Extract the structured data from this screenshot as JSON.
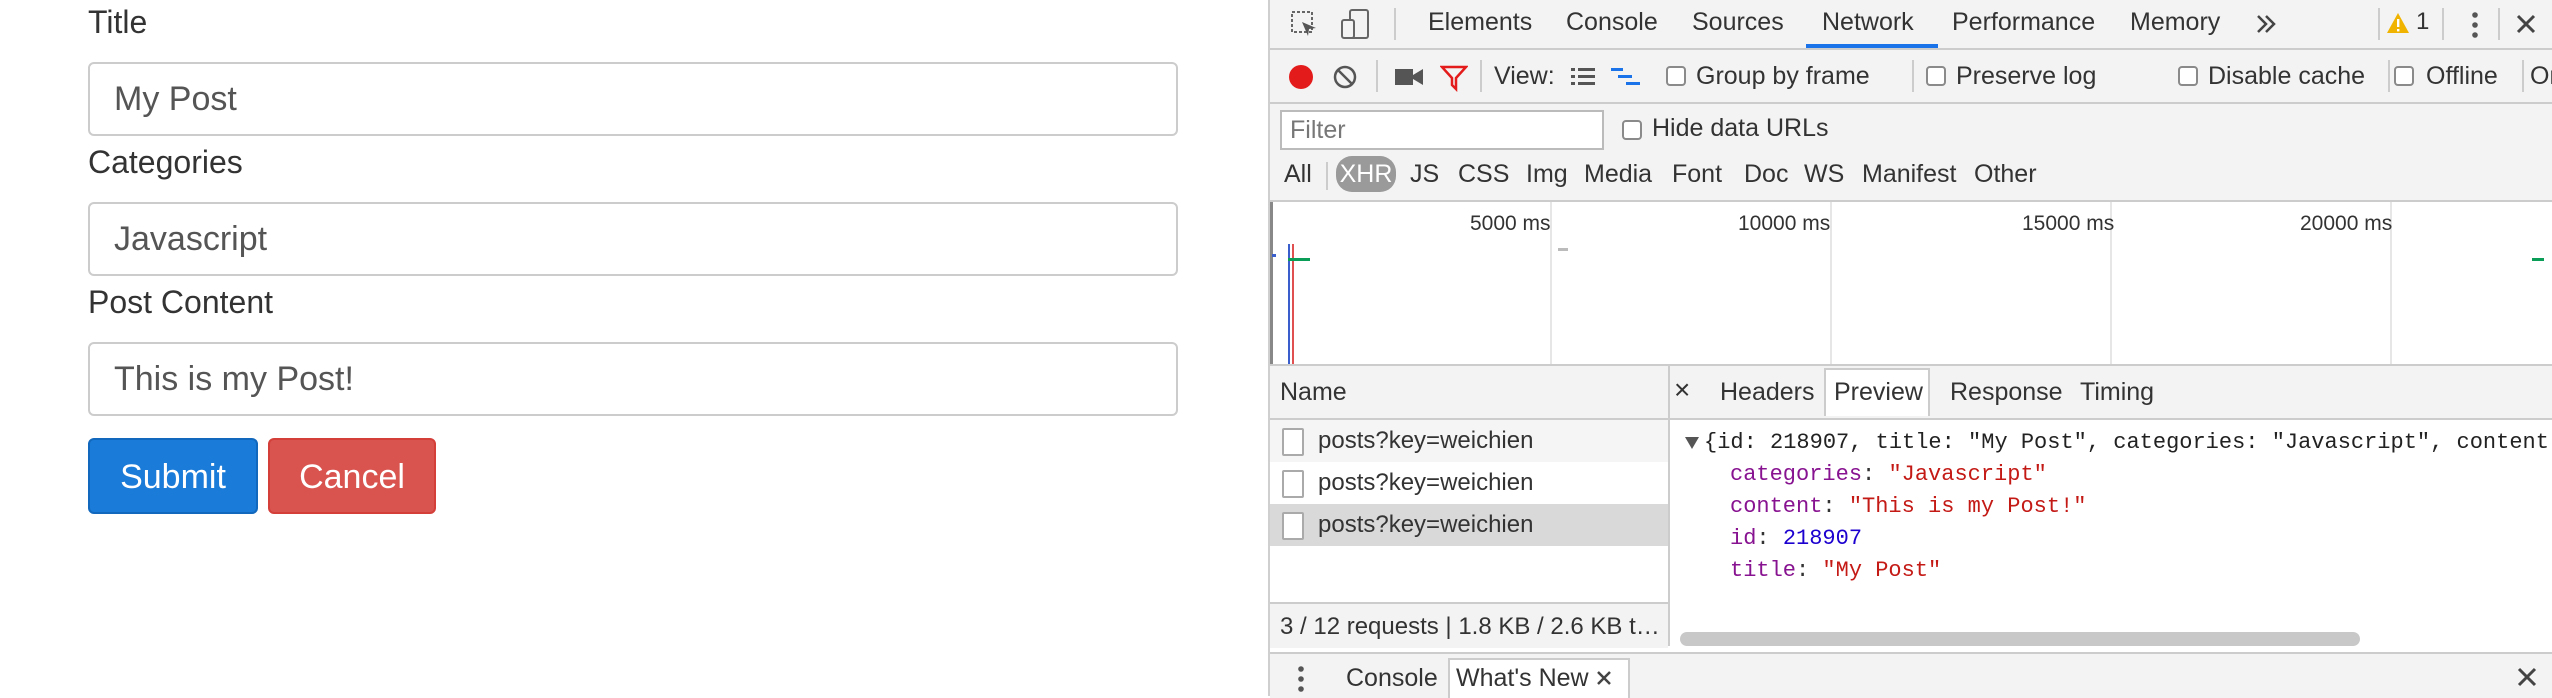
{
  "form": {
    "title_label": "Title",
    "title_value": "My Post",
    "categories_label": "Categories",
    "categories_value": "Javascript",
    "content_label": "Post Content",
    "content_value": "This is my Post!",
    "submit_label": "Submit",
    "cancel_label": "Cancel",
    "colors": {
      "submit": "#1a7bd8",
      "cancel": "#d9534f"
    }
  },
  "devtools": {
    "tabs": [
      "Elements",
      "Console",
      "Sources",
      "Network",
      "Performance",
      "Memory"
    ],
    "active_tab": "Network",
    "more_tabs_icon": "double-chevron-right-icon",
    "warning_count": "1",
    "toolbar": {
      "view_label": "View:",
      "group_by_frame": "Group by frame",
      "preserve_log": "Preserve log",
      "disable_cache": "Disable cache",
      "offline": "Offline",
      "online_truncated": "Onl"
    },
    "filter": {
      "placeholder": "Filter",
      "hide_data_urls": "Hide data URLs",
      "types": [
        "All",
        "XHR",
        "JS",
        "CSS",
        "Img",
        "Media",
        "Font",
        "Doc",
        "WS",
        "Manifest",
        "Other"
      ],
      "active_type": "XHR"
    },
    "timeline": {
      "ticks": [
        "5000 ms",
        "10000 ms",
        "15000 ms",
        "20000 ms"
      ]
    },
    "requests": {
      "header": "Name",
      "rows": [
        "posts?key=weichien",
        "posts?key=weichien",
        "posts?key=weichien"
      ],
      "status": "3 / 12 requests | 1.8 KB / 2.6 KB t…"
    },
    "detail": {
      "close": "×",
      "tabs": [
        "Headers",
        "Preview",
        "Response",
        "Timing"
      ],
      "active_tab": "Preview",
      "summary": "{id: 218907, title: \"My Post\", categories: \"Javascript\", content",
      "props": [
        {
          "key": "categories",
          "value": "\"Javascript\"",
          "kind": "string"
        },
        {
          "key": "content",
          "value": "\"This is my Post!\"",
          "kind": "string"
        },
        {
          "key": "id",
          "value": "218907",
          "kind": "number"
        },
        {
          "key": "title",
          "value": "\"My Post\"",
          "kind": "string"
        }
      ]
    },
    "drawer": {
      "tabs": [
        "Console",
        "What's New"
      ],
      "active_tab": "What's New"
    }
  }
}
